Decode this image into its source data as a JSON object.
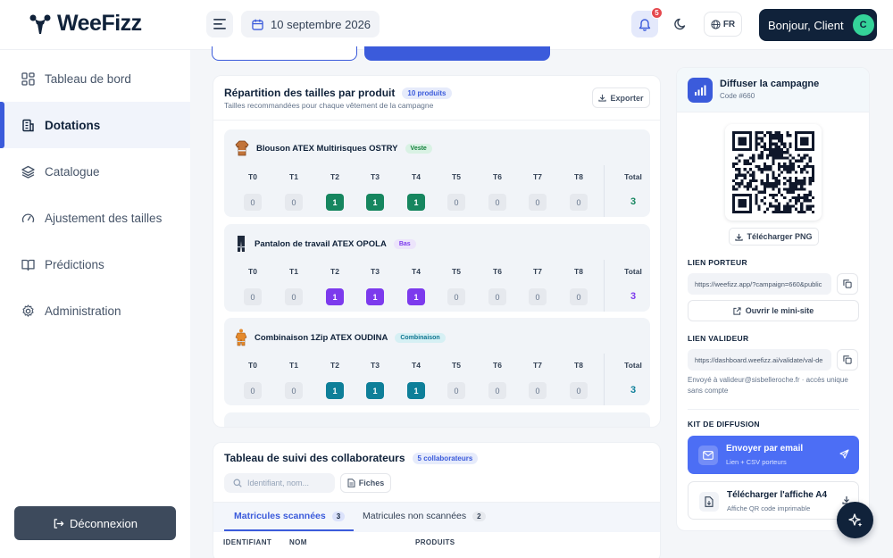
{
  "brand": {
    "name": "WeeFizz"
  },
  "header": {
    "date": "10 septembre 2026",
    "notifications_count": "5",
    "language": "FR",
    "greeting": "Bonjour, Client",
    "avatar_initial": "C"
  },
  "sidebar": {
    "items": [
      {
        "label": "Tableau de bord",
        "icon": "dashboard-icon",
        "active": false
      },
      {
        "label": "Dotations",
        "icon": "building-icon",
        "active": true
      },
      {
        "label": "Catalogue",
        "icon": "layers-icon",
        "active": false
      },
      {
        "label": "Ajustement des tailles",
        "icon": "gauge-icon",
        "active": false
      },
      {
        "label": "Prédictions",
        "icon": "book-icon",
        "active": false
      },
      {
        "label": "Administration",
        "icon": "gear-icon",
        "active": false
      }
    ],
    "logout_label": "Déconnexion"
  },
  "repartition": {
    "title": "Répartition des tailles par produit",
    "count_label": "10 produits",
    "subtitle": "Tailles recommandées pour chaque vêtement de la campagne",
    "export_label": "Exporter",
    "size_headers": [
      "T0",
      "T1",
      "T2",
      "T3",
      "T4",
      "T5",
      "T6",
      "T7",
      "T8"
    ],
    "total_header": "Total",
    "products": [
      {
        "name": "Blouson ATEX Multirisques OSTRY",
        "tag": "Veste",
        "tag_bg": "#d9f2e4",
        "tag_color": "#15803d",
        "accent": "#16865f",
        "values": [
          0,
          0,
          1,
          1,
          1,
          0,
          0,
          0,
          0
        ],
        "total": "3"
      },
      {
        "name": "Pantalon de travail ATEX OPOLA",
        "tag": "Bas",
        "tag_bg": "#ece4fb",
        "tag_color": "#7c3aed",
        "accent": "#7c3aed",
        "values": [
          0,
          0,
          1,
          1,
          1,
          0,
          0,
          0,
          0
        ],
        "total": "3"
      },
      {
        "name": "Combinaison 1Zip ATEX OUDINA",
        "tag": "Combinaison",
        "tag_bg": "#d6f0f4",
        "tag_color": "#0e7490",
        "accent": "#0e7f99",
        "values": [
          0,
          0,
          1,
          1,
          1,
          0,
          0,
          0,
          0
        ],
        "total": "3"
      }
    ]
  },
  "suivi": {
    "title": "Tableau de suivi des collaborateurs",
    "count_label": "5 collaborateurs",
    "search_placeholder": "Identifiant, nom...",
    "fiches_label": "Fiches",
    "tabs": [
      {
        "label": "Matricules scannées",
        "count": "3",
        "active": true
      },
      {
        "label": "Matricules non scannées",
        "count": "2",
        "active": false
      }
    ],
    "columns": [
      "IDENTIFIANT",
      "NOM",
      "PRODUITS"
    ]
  },
  "diffusion": {
    "title": "Diffuser la campagne",
    "code": "Code #660",
    "download_png": "Télécharger PNG",
    "porteur_label": "LIEN PORTEUR",
    "porteur_link": "https://weefizz.app/?campaign=660&public",
    "mini_site_label": "Ouvrir le mini-site",
    "valideur_label": "LIEN VALIDEUR",
    "valideur_link": "https://dashboard.weefizz.ai/validate/val-de",
    "sent_note": "Envoyé à valideur@sisbelleroche.fr · accès unique sans compte",
    "kit_label": "KIT DE DIFFUSION",
    "email_title": "Envoyer par email",
    "email_sub": "Lien + CSV porteurs",
    "affiche_title": "Télécharger l'affiche A4",
    "affiche_sub": "Affiche QR code imprimable"
  },
  "colors": {
    "primary": "#3b5bdb",
    "navy": "#10223a",
    "green": "#16865f",
    "purple": "#7c3aed",
    "teal": "#0e7f99"
  }
}
